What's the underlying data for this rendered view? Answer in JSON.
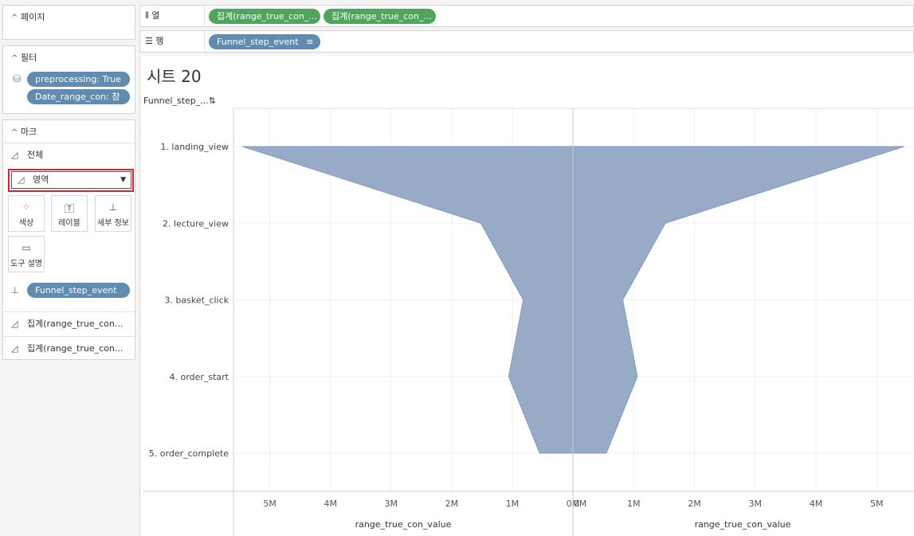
{
  "left_panel": {
    "pages": {
      "title": "페이지"
    },
    "filters": {
      "title": "필터",
      "items": [
        "preprocessing: True",
        "Date_range_con: 참"
      ]
    },
    "marks": {
      "title": "마크",
      "all_label": "전체",
      "mark_type": "영역",
      "buttons": {
        "color": "색상",
        "label": "레이블",
        "detail": "세부 정보",
        "tooltip": "도구 설명"
      },
      "detail_pill": "Funnel_step_event",
      "measure_rows": [
        "집계(range_true_con...",
        "집계(range_true_con..."
      ]
    }
  },
  "shelves": {
    "columns": {
      "label": "열",
      "pills": [
        "집계(range_true_con_...",
        "집계(range_true_con_..."
      ]
    },
    "rows": {
      "label": "행",
      "pills": [
        "Funnel_step_event"
      ]
    }
  },
  "sheet": {
    "title": "시트 20",
    "row_field_header": "Funnel_step_..."
  },
  "chart_data": {
    "type": "area",
    "categories": [
      "1. landing_view",
      "2. lecture_view",
      "3. basket_click",
      "4. order_start",
      "5. order_complete"
    ],
    "series": [
      {
        "values": [
          5450000,
          1520000,
          820000,
          1060000,
          550000
        ]
      },
      {
        "values": [
          5450000,
          1520000,
          820000,
          1060000,
          550000
        ]
      }
    ],
    "left_axis": {
      "label": "range_true_con_value",
      "ticks": [
        "5M",
        "4M",
        "3M",
        "2M",
        "1M",
        "0M"
      ],
      "reversed": true,
      "range": [
        0,
        5600000
      ]
    },
    "right_axis": {
      "label": "range_true_con_value",
      "ticks": [
        "0M",
        "1M",
        "2M",
        "3M",
        "4M",
        "5M"
      ],
      "range": [
        0,
        5600000
      ]
    },
    "fill_color": "#97aac6",
    "stroke_color": "#7f9bc4",
    "grid": true
  }
}
